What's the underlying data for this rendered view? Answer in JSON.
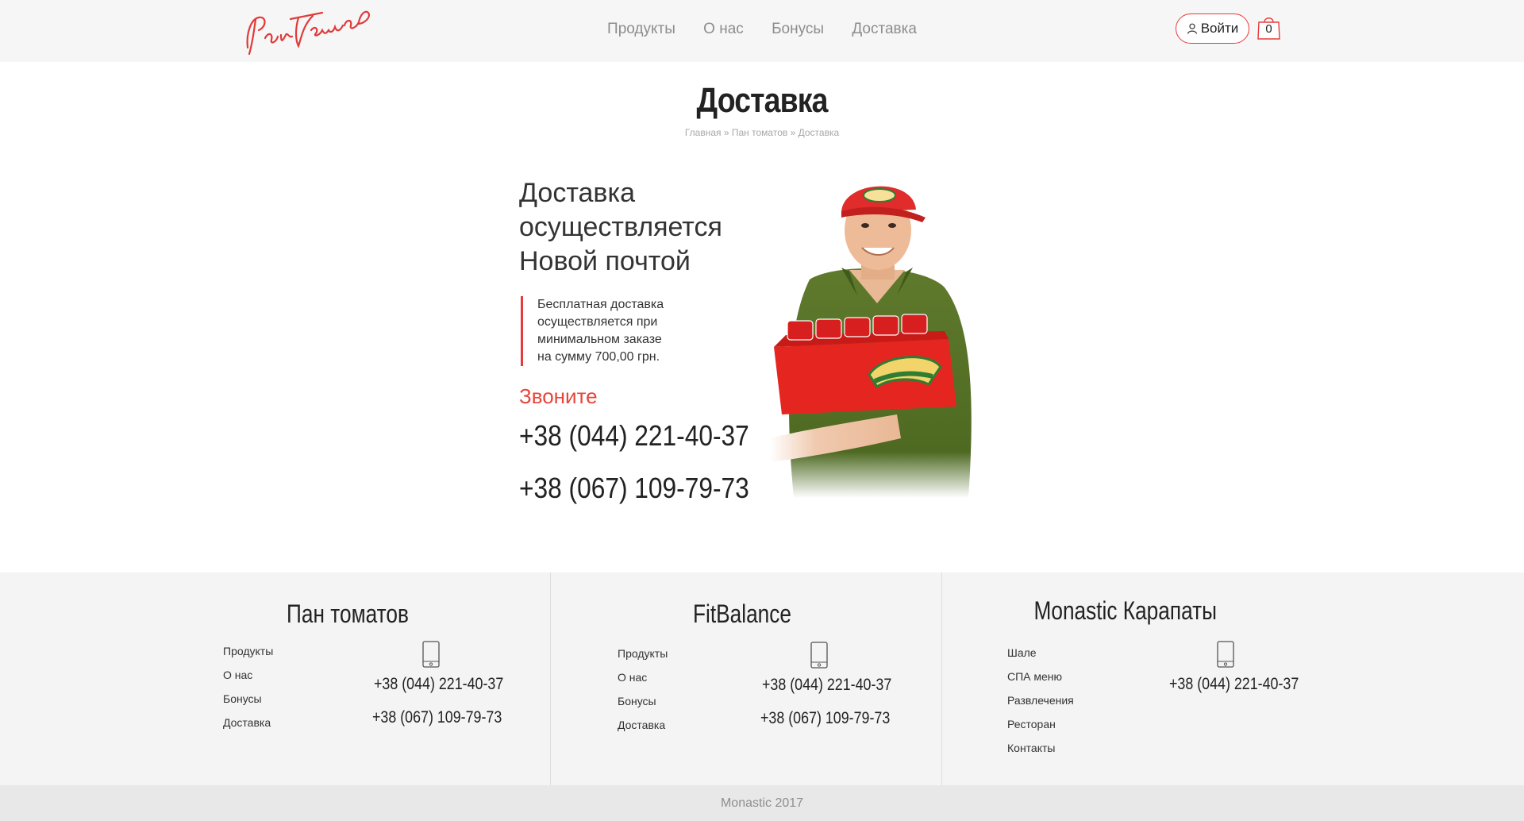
{
  "header": {
    "logo_text": "Пан Томатов",
    "nav": [
      "Продукты",
      "О нас",
      "Бонусы",
      "Доставка"
    ],
    "login_label": "Войти",
    "cart_count": "0"
  },
  "page": {
    "title": "Доставка",
    "breadcrumb": [
      "Главная",
      "Пан томатов",
      "Доставка"
    ]
  },
  "main": {
    "heading_lines": [
      "Доставка",
      "осуществляется",
      "Новой почтой"
    ],
    "note_lines": [
      "Бесплатная доставка",
      "осуществляется при",
      "минимальном заказе",
      "на сумму 700,00 грн."
    ],
    "call_label": "Звоните",
    "phones": [
      "+38 (044) 221-40-37",
      "+38 (067) 109-79-73"
    ]
  },
  "footer": {
    "columns": [
      {
        "title": "Пан томатов",
        "links": [
          "Продукты",
          "О нас",
          "Бонусы",
          "Доставка"
        ],
        "phones": [
          "+38 (044) 221-40-37",
          "+38 (067) 109-79-73"
        ]
      },
      {
        "title": "FitBalance",
        "links": [
          "Продукты",
          "О нас",
          "Бонусы",
          "Доставка"
        ],
        "phones": [
          "+38 (044) 221-40-37",
          "+38 (067) 109-79-73"
        ]
      },
      {
        "title": "Monastic Карапаты",
        "links": [
          "Шале",
          "СПА меню",
          "Развлечения",
          "Ресторан",
          "Контакты"
        ],
        "phones": [
          "+38 (044) 221-40-37"
        ]
      }
    ],
    "copyright": "Monastic 2017"
  },
  "colors": {
    "accent": "#e53b3b",
    "header_bg": "#f6f6f6",
    "footer_bg": "#f4f4f4"
  }
}
